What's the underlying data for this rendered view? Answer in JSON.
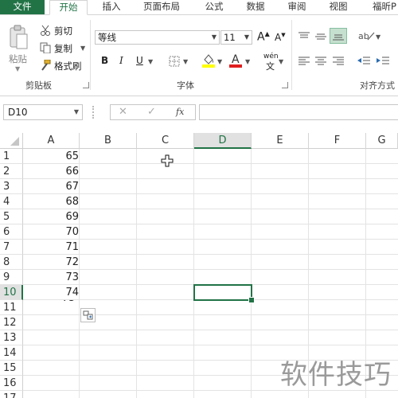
{
  "ribbon_tabs": [
    {
      "label": "文件"
    },
    {
      "label": "开始"
    },
    {
      "label": "插入"
    },
    {
      "label": "页面布局"
    },
    {
      "label": "公式"
    },
    {
      "label": "数据"
    },
    {
      "label": "审阅"
    },
    {
      "label": "视图"
    },
    {
      "label": "福昕P"
    }
  ],
  "clipboard": {
    "paste": "粘贴",
    "cut": "剪切",
    "copy": "复制",
    "format_painter": "格式刷",
    "group_label": "剪贴板"
  },
  "font": {
    "font_name": "等线",
    "font_size": "11",
    "bold": "B",
    "italic": "I",
    "underline": "U",
    "increase": "A",
    "decrease": "A",
    "font_color": "A",
    "phonetic": "wén",
    "group_label": "字体"
  },
  "alignment": {
    "group_label": "对齐方式"
  },
  "formula_bar": {
    "name_box": "D10",
    "cancel": "✕",
    "enter": "✓",
    "fx": "fx"
  },
  "columns": [
    "A",
    "B",
    "C",
    "D",
    "E",
    "F",
    "G"
  ],
  "rows": [
    "1",
    "2",
    "3",
    "4",
    "5",
    "6",
    "7",
    "8",
    "9",
    "10",
    "11",
    "12",
    "13",
    "14",
    "15",
    "16",
    "17"
  ],
  "column_a_values": [
    "65",
    "66",
    "67",
    "68",
    "69",
    "70",
    "71",
    "72",
    "73",
    "74"
  ],
  "active_cell": "D10",
  "watermark": "软件技巧",
  "colors": {
    "accent": "#217346"
  }
}
